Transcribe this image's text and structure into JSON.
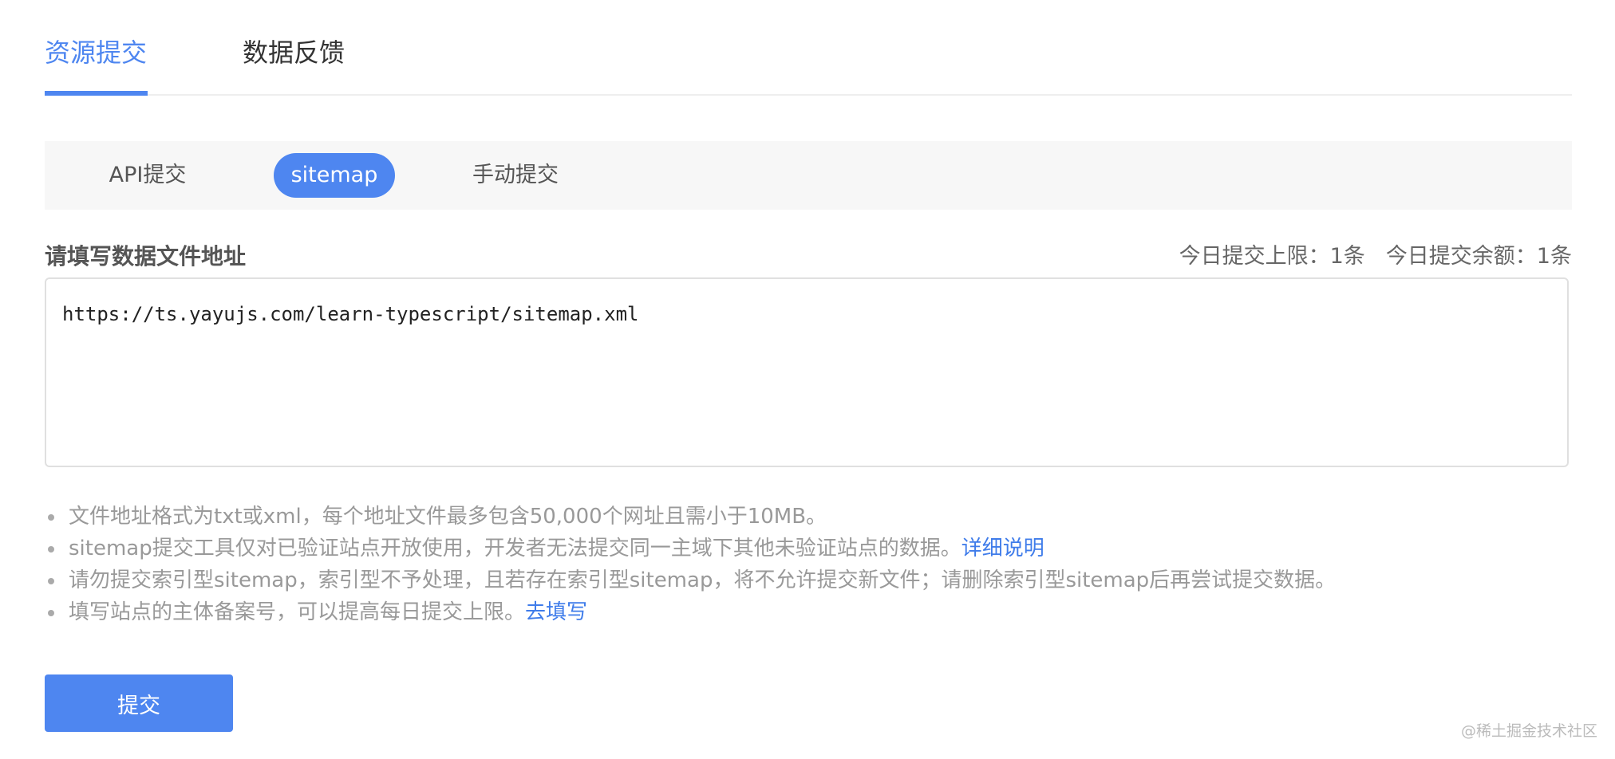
{
  "top_tabs": [
    {
      "label": "资源提交",
      "active": true
    },
    {
      "label": "数据反馈",
      "active": false
    }
  ],
  "sub_tabs": [
    {
      "label": "API提交",
      "active": false
    },
    {
      "label": "sitemap",
      "active": true
    },
    {
      "label": "手动提交",
      "active": false
    }
  ],
  "form": {
    "field_label": "请填写数据文件地址",
    "quota_limit": "今日提交上限：1条",
    "quota_remaining": "今日提交余额：1条",
    "url_value": "https://ts.yayujs.com/learn-typescript/sitemap.xml"
  },
  "notes": [
    {
      "text": "文件地址格式为txt或xml，每个地址文件最多包含50,000个网址且需小于10MB。"
    },
    {
      "text": "sitemap提交工具仅对已验证站点开放使用，开发者无法提交同一主域下其他未验证站点的数据。",
      "link": "详细说明"
    },
    {
      "text": "请勿提交索引型sitemap，索引型不予处理，且若存在索引型sitemap，将不允许提交新文件；请删除索引型sitemap后再尝试提交数据。"
    },
    {
      "text": "填写站点的主体备案号，可以提高每日提交上限。",
      "link": "去填写"
    }
  ],
  "submit_label": "提交",
  "watermark": "@稀土掘金技术社区",
  "colors": {
    "accent": "#4e86f0",
    "link": "#3f7cea",
    "muted_text": "#999999"
  }
}
